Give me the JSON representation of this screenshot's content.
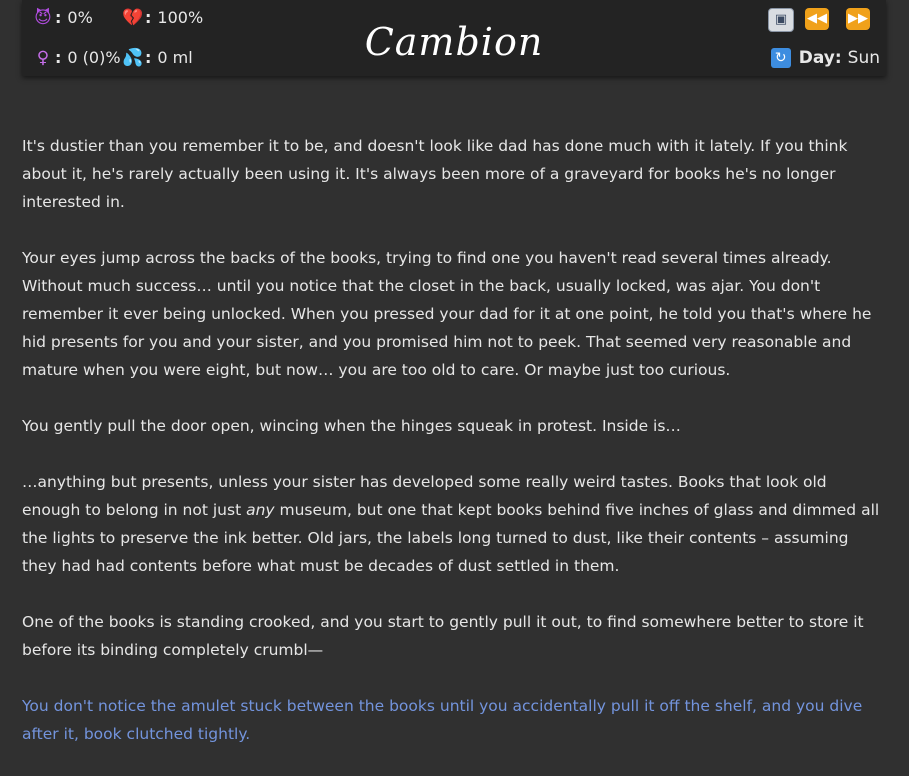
{
  "header": {
    "logo": "Cambion",
    "stats": {
      "corruption_icon": "devil-face-icon",
      "corruption": "0%",
      "broken_heart_icon": "broken-heart-icon",
      "broken_heart": "100%",
      "female_icon": "female-sign-icon",
      "female": "0 (0)%",
      "droplets_icon": "droplets-icon",
      "droplets": "0 ml"
    },
    "toolbar": {
      "save_icon": "floppy-disk-icon",
      "rewind_icon": "rewind-icon",
      "fast_forward_icon": "fast-forward-icon"
    },
    "day": {
      "icon": "cycle-arrows-icon",
      "label": "Day:",
      "value": "Sun"
    }
  },
  "story": {
    "p1": "It's dustier than you remember it to be, and doesn't look like dad has done much with it lately. If you think about it, he's rarely actually been using it. It's always been more of a graveyard for books he's no longer interested in.",
    "p2": "Your eyes jump across the backs of the books, trying to find one you haven't read several times already. Without much success… until you notice that the closet in the back, usually locked, was ajar. You don't remember it ever being unlocked. When you pressed your dad for it at one point, he told you that's where he hid presents for you and your sister, and you promised him not to peek. That seemed very reasonable and mature when you were eight, but now… you are too old to care. Or maybe just too curious.",
    "p3": "You gently pull the door open, wincing when the hinges squeak in protest. Inside is…",
    "p4_before": "…anything but presents, unless your sister has developed some really weird tastes. Books that look old enough to belong in not just ",
    "p4_em": "any",
    "p4_after": " museum, but one that kept books behind five inches of glass and dimmed all the lights to preserve the ink better. Old jars, the labels long turned to dust, like their contents – assuming they had had contents before what must be decades of dust settled in them.",
    "p5": "One of the books is standing crooked, and you start to gently pull it out, to find somewhere better to store it before its binding completely crumbl—",
    "choice": "You don't notice the amulet stuck between the books until you accidentally pull it off the shelf, and you dive after it, book clutched tightly."
  },
  "colors": {
    "background": "#303030",
    "header": "#232323",
    "text": "#e6e6e6",
    "link": "#7394dd",
    "accent_button": "#f0a11a"
  }
}
